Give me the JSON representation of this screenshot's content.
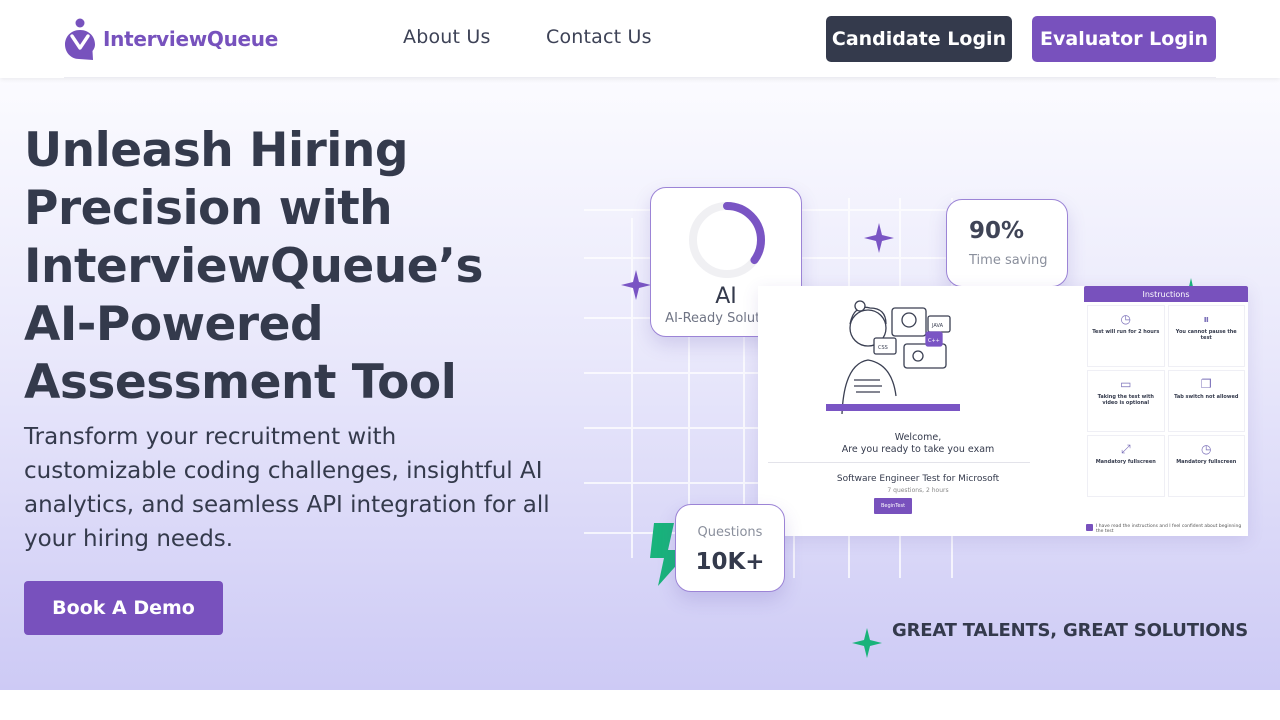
{
  "brand": {
    "name": "InterviewQueue",
    "color": "#7752bd"
  },
  "nav": {
    "about": "About Us",
    "contact": "Contact Us"
  },
  "buttons": {
    "candidate_login": "Candidate Login",
    "evaluator_login": "Evaluator Login"
  },
  "hero": {
    "title": "Unleash Hiring Precision with InterviewQueue’s AI-Powered Assessment Tool",
    "subtitle": "Transform your recruitment with customizable coding challenges, insightful AI analytics, and seamless API integration for all your hiring needs.",
    "cta": "Book A Demo"
  },
  "illustration": {
    "ai_card": {
      "title": "AI",
      "subtitle": "AI-Ready Solutions",
      "progress": 0.35
    },
    "stat_card": {
      "value": "90%",
      "label": "Time saving"
    },
    "questions_card": {
      "label": "Questions",
      "value": "10K+"
    },
    "screen": {
      "welcome_line1": "Welcome,",
      "welcome_line2": "Are you ready to take you exam",
      "test_name": "Software Engineer Test for Microsoft",
      "test_meta": "7 questions, 2 hours",
      "begin": "BeginTest",
      "instructions_title": "Instructions",
      "instructions": [
        "Test will run for 2 hours",
        "You cannot pause the test",
        "Taking the test with video is optional",
        "Tab switch not allowed",
        "Mandatory fullscreen",
        "Mandatory fullscreen"
      ],
      "instructions_ack": "I have read the instructions and I feel confident about beginning the test"
    },
    "tagline": "GREAT TALENTS, GREAT SOLUTIONS"
  },
  "colors": {
    "primary": "#7851bd",
    "dark": "#343a4c",
    "accent_green": "#19b37b"
  }
}
